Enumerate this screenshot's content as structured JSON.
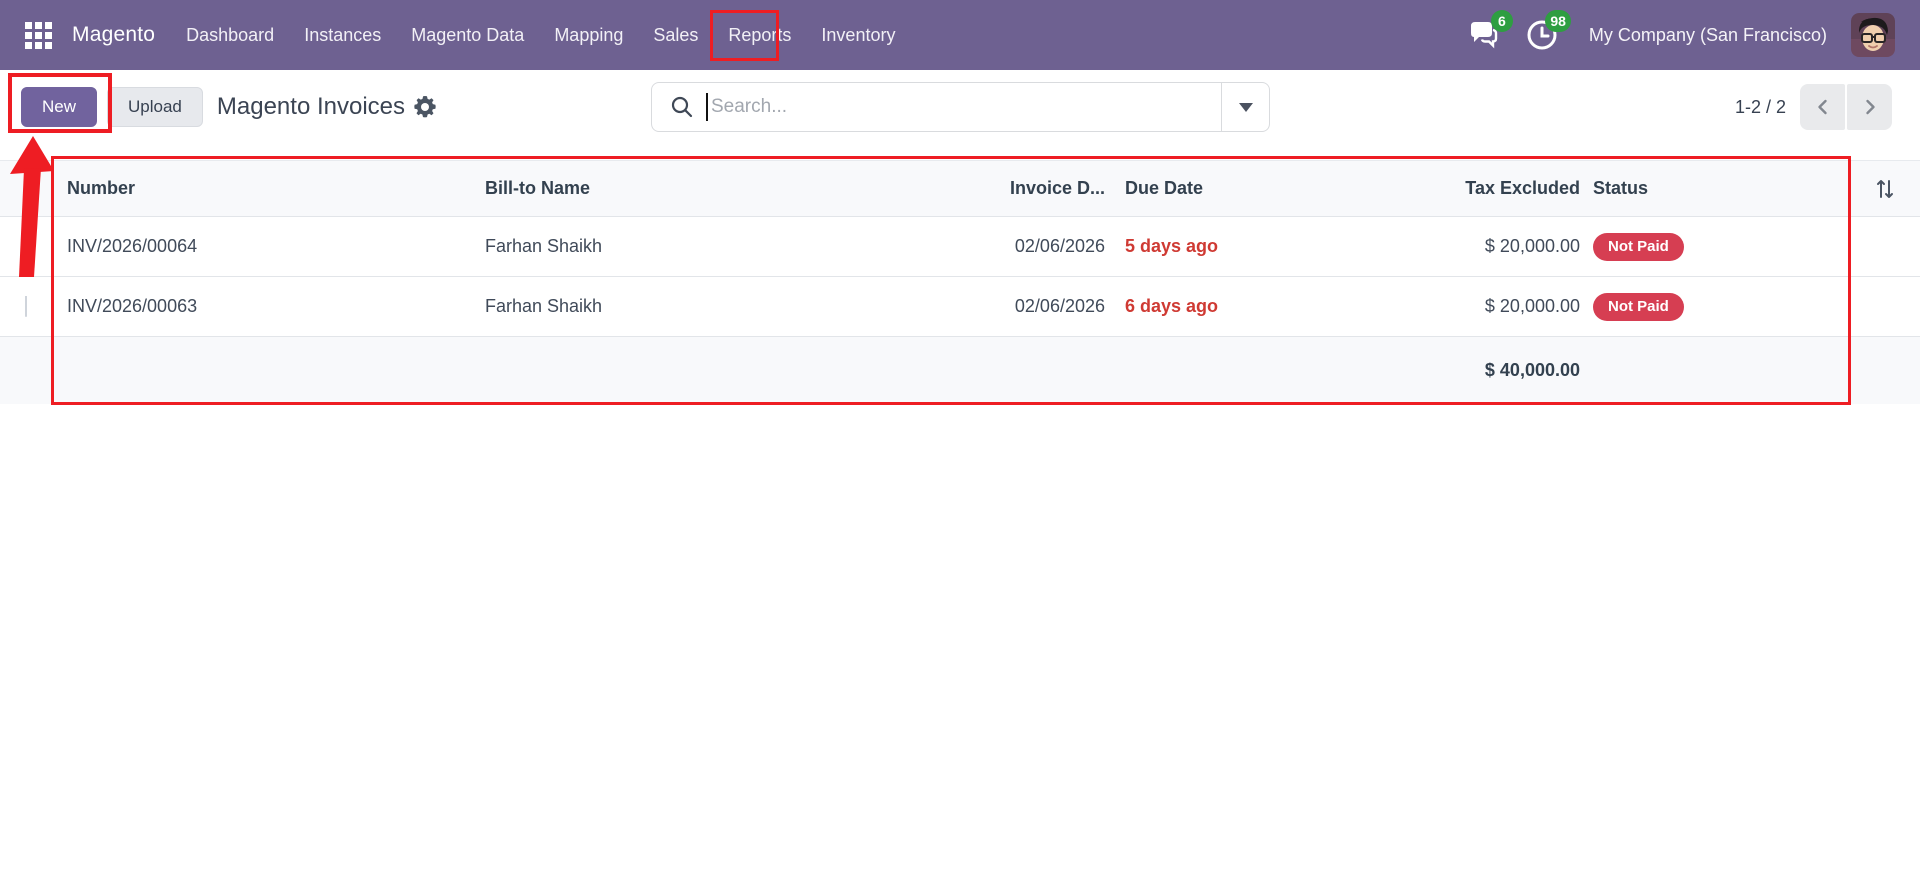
{
  "nav": {
    "brand": "Magento",
    "items": [
      "Dashboard",
      "Instances",
      "Magento Data",
      "Mapping",
      "Sales",
      "Reports",
      "Inventory"
    ],
    "highlighted_item": "Sales",
    "messages_badge": "6",
    "activities_badge": "98",
    "company": "My Company (San Francisco)"
  },
  "control_panel": {
    "new_button": "New",
    "upload_button": "Upload",
    "title": "Magento Invoices",
    "search_placeholder": "Search...",
    "pager": "1-2 / 2"
  },
  "table": {
    "columns": [
      "Number",
      "Bill-to Name",
      "Invoice D...",
      "Due Date",
      "Tax Excluded",
      "Status"
    ],
    "rows": [
      {
        "number": "INV/2026/00064",
        "bill_to": "Farhan Shaikh",
        "invoice_date": "02/06/2026",
        "due_date": "5 days ago",
        "tax_excluded": "$ 20,000.00",
        "status": "Not Paid"
      },
      {
        "number": "INV/2026/00063",
        "bill_to": "Farhan Shaikh",
        "invoice_date": "02/06/2026",
        "due_date": "6 days ago",
        "tax_excluded": "$ 20,000.00",
        "status": "Not Paid"
      }
    ],
    "footer_total": "$ 40,000.00"
  },
  "colors": {
    "navbar": "#6e6191",
    "primary_button": "#71639e",
    "badge_green": "#2e9e41",
    "status_red": "#d63e52",
    "overdue_red": "#cf3a33",
    "annotation_red": "#ee1d23"
  }
}
